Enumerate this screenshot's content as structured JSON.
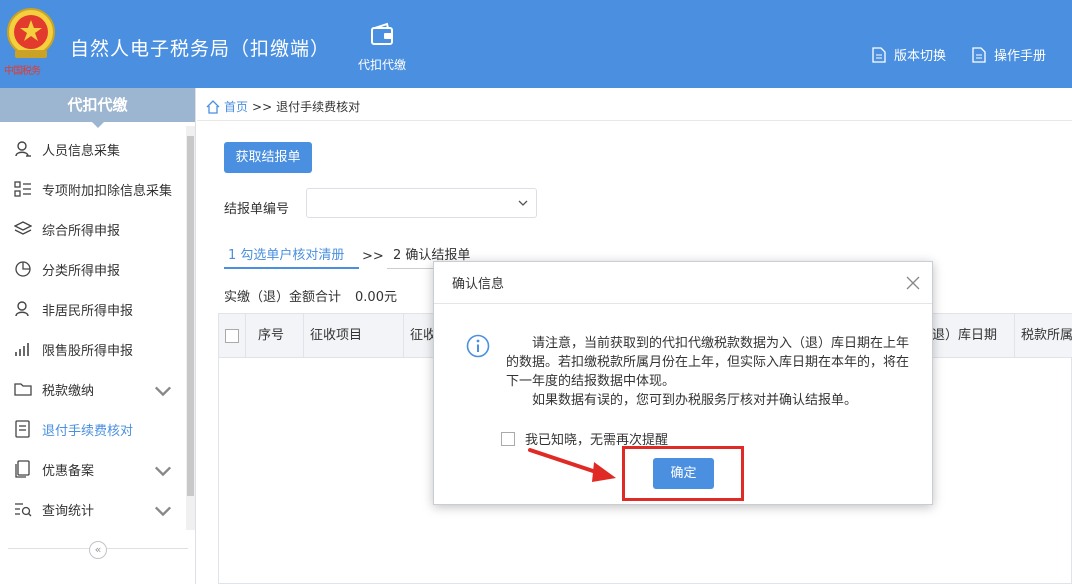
{
  "header": {
    "emblem_text": "中国税务",
    "app_title": "自然人电子税务局（扣缴端）",
    "nav_item": "代扣代缴",
    "version_switch": "版本切换",
    "manual": "操作手册"
  },
  "sidebar": {
    "title": "代扣代缴",
    "items": [
      {
        "label": "人员信息采集",
        "icon": "person-icon"
      },
      {
        "label": "专项附加扣除信息采集",
        "icon": "list-icon"
      },
      {
        "label": "综合所得申报",
        "icon": "layers-icon"
      },
      {
        "label": "分类所得申报",
        "icon": "pie-icon"
      },
      {
        "label": "非居民所得申报",
        "icon": "person-icon"
      },
      {
        "label": "限售股所得申报",
        "icon": "bar-chart-icon"
      },
      {
        "label": "税款缴纳",
        "icon": "folder-icon"
      },
      {
        "label": "退付手续费核对",
        "icon": "document-check-icon"
      },
      {
        "label": "优惠备案",
        "icon": "copy-icon"
      },
      {
        "label": "查询统计",
        "icon": "search-list-icon"
      }
    ],
    "active_index": 7,
    "collapse_glyph": "«"
  },
  "breadcrumb": {
    "home": "首页",
    "sep": ">>",
    "current": "退付手续费核对"
  },
  "main": {
    "fetch_button": "获取结报单",
    "report_no_label": "结报单编号",
    "report_no_value": "",
    "step1": "1 勾选单户核对清册",
    "step_sep": ">>",
    "step2": "2 确认结报单",
    "total_label": "实缴（退）金额合计",
    "total_value": "0.00元",
    "columns": [
      "序号",
      "征收项目",
      "征收",
      "（退）库日期",
      "税款所属"
    ]
  },
  "dialog": {
    "title": "确认信息",
    "message_1": "请注意，当前获取到的代扣代缴税款数据为入（退）库日期在上年的数据。若扣缴税款所属月份在上年，但实际入库日期在本年的，将在下一年度的结报数据中体现。",
    "message_2": "如果数据有误的，您可到办税服务厅核对并确认结报单。",
    "checkbox_label": "我已知晓，无需再次提醒",
    "checkbox_checked": false,
    "ok_button": "确定"
  },
  "colors": {
    "primary": "#4a8fe0",
    "sidebar_title_bg": "#9cb5d0",
    "annotation_red": "#e02a25"
  }
}
